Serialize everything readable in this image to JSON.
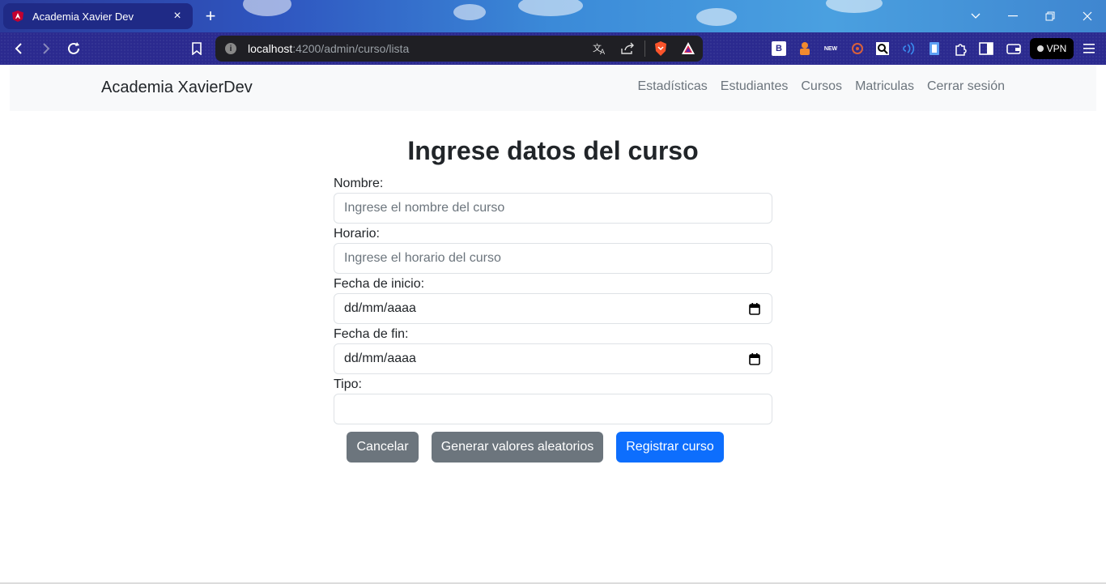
{
  "browser": {
    "tab_title": "Academia Xavier Dev",
    "url_host": "localhost",
    "url_path": ":4200/admin/curso/lista",
    "vpn_label": "VPN",
    "ext_new": "NEW",
    "ext_b": "B"
  },
  "navbar": {
    "brand": "Academia XavierDev",
    "links": [
      "Estadísticas",
      "Estudiantes",
      "Cursos",
      "Matriculas",
      "Cerrar sesión"
    ]
  },
  "form": {
    "heading": "Ingrese datos del curso",
    "nombre_label": "Nombre:",
    "nombre_placeholder": "Ingrese el nombre del curso",
    "horario_label": "Horario:",
    "horario_placeholder": "Ingrese el horario del curso",
    "fecha_inicio_label": "Fecha de inicio:",
    "fecha_inicio_value": "dd/mm/aaaa",
    "fecha_fin_label": "Fecha de fin:",
    "fecha_fin_value": "dd/mm/aaaa",
    "tipo_label": "Tipo:",
    "tipo_value": ""
  },
  "buttons": {
    "cancel": "Cancelar",
    "random": "Generar valores aleatorios",
    "submit": "Registrar curso"
  },
  "colors": {
    "primary": "#0d6efd",
    "secondary": "#6c757d",
    "navbar_bg": "#f8f9fa"
  }
}
